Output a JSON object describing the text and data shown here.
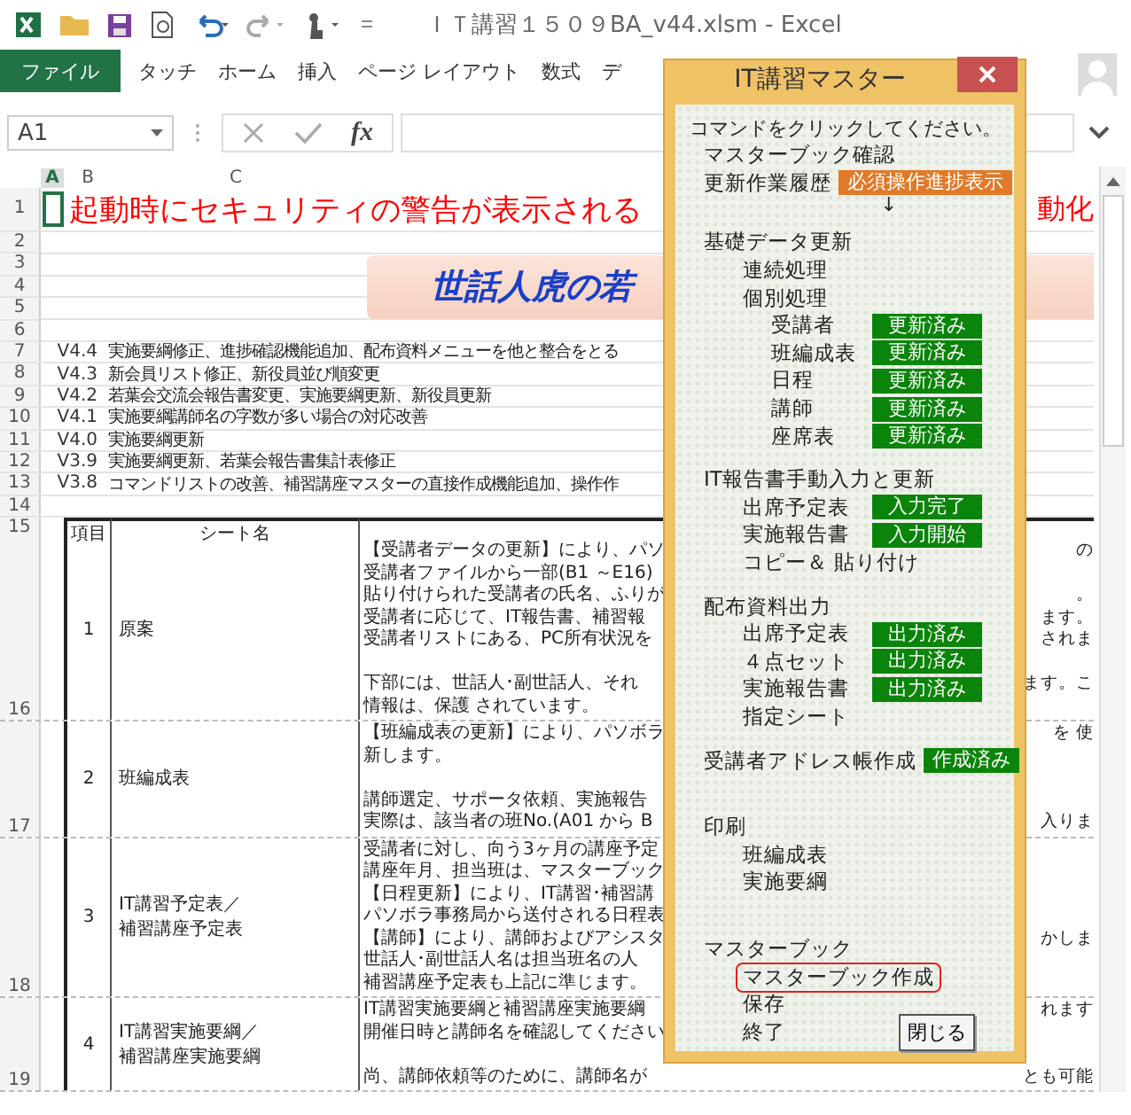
{
  "window": {
    "title": "ＩＴ講習１５０９BA_v44.xlsm - Excel"
  },
  "ribbon_tabs": [
    {
      "label": "ファイル",
      "selected": true
    },
    {
      "label": "タッチ",
      "selected": false
    },
    {
      "label": "ホーム",
      "selected": false
    },
    {
      "label": "挿入",
      "selected": false
    },
    {
      "label": "ページ レイアウト",
      "selected": false
    },
    {
      "label": "数式",
      "selected": false
    },
    {
      "label": "デ",
      "selected": false
    }
  ],
  "formula_bar": {
    "name_box": "A1",
    "fx": "fx"
  },
  "column_headers": [
    "A",
    "B",
    "C"
  ],
  "sheet": {
    "title_row": {
      "number": "1",
      "text": "起動時にセキュリティの警告が表示される",
      "right": "動化"
    },
    "blank_rows": [
      "2",
      "3",
      "4",
      "5",
      "6"
    ],
    "banner": "世話人虎の若",
    "versions": [
      {
        "row": "7",
        "version": "V4.4",
        "text": "実施要綱修正、進捗確認機能追加、配布資料メニューを他と整合をとる"
      },
      {
        "row": "8",
        "version": "V4.3",
        "text": "新会員リスト修正、新役員並び順変更"
      },
      {
        "row": "9",
        "version": "V4.2",
        "text": "若葉会交流会報告書変更、実施要綱更新、新役員更新"
      },
      {
        "row": "10",
        "version": "V4.1",
        "text": "実施要綱講師名の字数が多い場合の対応改善"
      },
      {
        "row": "11",
        "version": "V4.0",
        "text": "実施要綱更新"
      },
      {
        "row": "12",
        "version": "V3.9",
        "text": "実施要綱更新、若葉会報告書集計表修正"
      },
      {
        "row": "13",
        "version": "V3.8",
        "text": "コマンドリストの改善、補習講座マスターの直接作成機能追加、操作作"
      }
    ],
    "spacer_row": "14",
    "table": {
      "header_row": "15",
      "columns": [
        "項目",
        "シート名"
      ],
      "rows": [
        {
          "row": "16",
          "number": "1",
          "name_lines": [
            "原案"
          ],
          "paragraphs": [
            [
              {
                "text": "【受講者データの更新】により、パソ",
                "right": "の"
              },
              {
                "text": "受講者ファイルから一部(B1 ～E16)"
              },
              {
                "text": "貼り付けられた受講者の氏名、ふりが",
                "right": "。"
              },
              {
                "text": "受講者に応じて、IT報告書、補習報",
                "right": "ます。"
              },
              {
                "text": "受講者リストにある、PC所有状況を",
                "right": "されま"
              }
            ],
            [
              {
                "text": "下部には、世話人･副世話人、それ",
                "right": "ます。こ"
              },
              {
                "text": "情報は、保護 されています。"
              }
            ]
          ]
        },
        {
          "row": "17",
          "number": "2",
          "name_lines": [
            "班編成表"
          ],
          "paragraphs": [
            [
              {
                "text": "【班編成表の更新】により、パソボラ",
                "right": "を 使"
              },
              {
                "text": "新します。"
              }
            ],
            [
              {
                "text": "講師選定、サポータ依頼、実施報告"
              },
              {
                "text": "実際は、該当者の班No.(A01 から B",
                "right": "入りま"
              }
            ]
          ]
        },
        {
          "row": "18",
          "number": "3",
          "name_lines": [
            "IT講習予定表／",
            "補習講座予定表"
          ],
          "paragraphs": [
            [
              {
                "text": "受講者に対し、向う3ヶ月の講座予定"
              },
              {
                "text": "講座年月、担当班は、マスターブック"
              },
              {
                "text": "【日程更新】により、IT講習･補習講"
              },
              {
                "text": "パソボラ事務局から送付される日程表"
              },
              {
                "text": "【講師】により、講師およびアシスタ",
                "right": "かしま"
              },
              {
                "text": "世話人･副世話人名は担当班名の人"
              },
              {
                "text": "補習講座予定表も上記に準じます。"
              }
            ]
          ]
        },
        {
          "row": "19",
          "number": "4",
          "name_lines": [
            "IT講習実施要綱／",
            "補習講座実施要綱"
          ],
          "paragraphs": [
            [
              {
                "text": "IT講習実施要綱と補習講座実施要綱",
                "right": "れます"
              },
              {
                "text": "開催日時と講師名を確認してください"
              }
            ],
            [
              {
                "text": "尚、講師依頼等のために、講師名が",
                "right": "とも可能"
              }
            ]
          ]
        }
      ]
    }
  },
  "dialog": {
    "title": "IT講習マスター",
    "instruction": "コマンドをクリックしてください。",
    "items": [
      {
        "label": "マスターブック確認",
        "selected": false
      },
      {
        "label": "更新作業履歴",
        "selected": false,
        "badge": {
          "text": "必須操作進捗表示",
          "color": "#e07a28"
        },
        "note": "↓"
      },
      {
        "label": "基礎データ更新",
        "selected": false,
        "children": [
          {
            "label": "連続処理",
            "selected": false
          },
          {
            "label": "個別処理",
            "selected": false,
            "children": [
              {
                "label": "受講者",
                "selected": false,
                "badge": {
                  "text": "更新済み",
                  "color": "#0a840a"
                }
              },
              {
                "label": "班編成表",
                "selected": false,
                "badge": {
                  "text": "更新済み",
                  "color": "#0a840a"
                }
              },
              {
                "label": "日程",
                "selected": false,
                "badge": {
                  "text": "更新済み",
                  "color": "#0a840a"
                }
              },
              {
                "label": "講師",
                "selected": false,
                "badge": {
                  "text": "更新済み",
                  "color": "#0a840a"
                }
              },
              {
                "label": "座席表",
                "selected": false,
                "badge": {
                  "text": "更新済み",
                  "color": "#0a840a"
                }
              }
            ]
          }
        ]
      },
      {
        "label": "IT報告書手動入力と更新",
        "selected": false,
        "children": [
          {
            "label": "出席予定表",
            "selected": false,
            "badge": {
              "text": "入力完了",
              "color": "#0a840a"
            }
          },
          {
            "label": "実施報告書",
            "selected": false,
            "badge": {
              "text": "入力開始",
              "color": "#0a840a"
            }
          },
          {
            "label": "コピー＆ 貼り付け",
            "selected": false
          }
        ]
      },
      {
        "label": "配布資料出力",
        "selected": false,
        "children": [
          {
            "label": "出席予定表",
            "selected": false,
            "badge": {
              "text": "出力済み",
              "color": "#0a840a"
            }
          },
          {
            "label": "４点セット",
            "selected": false,
            "badge": {
              "text": "出力済み",
              "color": "#0a840a"
            }
          },
          {
            "label": "実施報告書",
            "selected": false,
            "badge": {
              "text": "出力済み",
              "color": "#0a840a"
            }
          },
          {
            "label": "指定シート",
            "selected": false
          }
        ]
      },
      {
        "label": "受講者アドレス帳作成",
        "selected": false,
        "badge": {
          "text": "作成済み",
          "color": "#0a840a"
        }
      },
      {
        "label": "印刷",
        "selected": false,
        "children": [
          {
            "label": "班編成表",
            "selected": false
          },
          {
            "label": "実施要綱",
            "selected": false
          }
        ]
      },
      {
        "label": "マスターブック",
        "selected": false,
        "children": [
          {
            "label": "マスターブック作成",
            "selected": true
          },
          {
            "label": "保存",
            "selected": false
          },
          {
            "label": "終了",
            "selected": false
          }
        ]
      }
    ],
    "close_button": "閉じる"
  }
}
